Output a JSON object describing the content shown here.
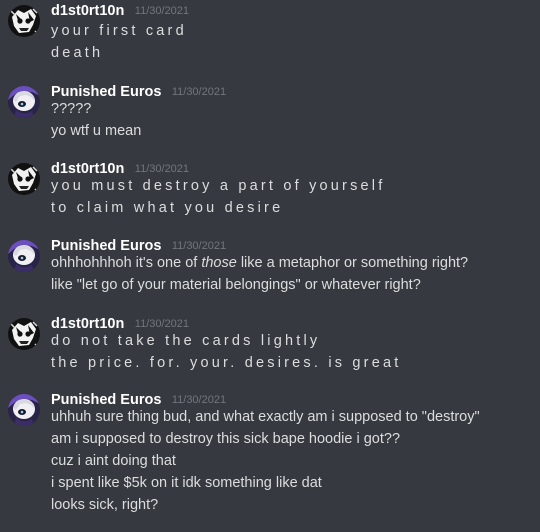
{
  "messages": [
    {
      "author": "d1st0rt10n",
      "timestamp": "11/30/2021",
      "avatar": "skull-avatar",
      "lines": [
        "your first card",
        "death"
      ]
    },
    {
      "author": "Punished Euros",
      "timestamp": "11/30/2021",
      "avatar": "anime-girl-avatar",
      "lines": [
        "?????",
        "yo wtf u mean"
      ]
    },
    {
      "author": "d1st0rt10n",
      "timestamp": "11/30/2021",
      "avatar": "skull-avatar",
      "lines": [
        "you must destroy a part of yourself",
        "to claim what you desire"
      ]
    },
    {
      "author": "Punished Euros",
      "timestamp": "11/30/2021",
      "avatar": "anime-girl-avatar",
      "line1_before": "ohhhohhhoh it's one of ",
      "line1_emphasis": "those",
      "line1_after": " like a metaphor or something right?",
      "line2": "like \"let go of your material belongings\" or whatever right?"
    },
    {
      "author": "d1st0rt10n",
      "timestamp": "11/30/2021",
      "avatar": "skull-avatar",
      "lines": [
        "do not take the cards lightly",
        "the price. for. your. desires. is great"
      ]
    },
    {
      "author": "Punished Euros",
      "timestamp": "11/30/2021",
      "avatar": "anime-girl-avatar",
      "lines": [
        "uhhuh sure thing bud, and what exactly am i supposed to \"destroy\"",
        "am i supposed to destroy this sick bape hoodie i got??",
        "cuz i aint doing that",
        "i spent like $5k on it idk something like dat",
        "looks sick, right?"
      ]
    }
  ],
  "colors": {
    "background": "#36393f",
    "username": "#ffffff",
    "timestamp": "#72767d",
    "message_text": "#dcddde"
  }
}
